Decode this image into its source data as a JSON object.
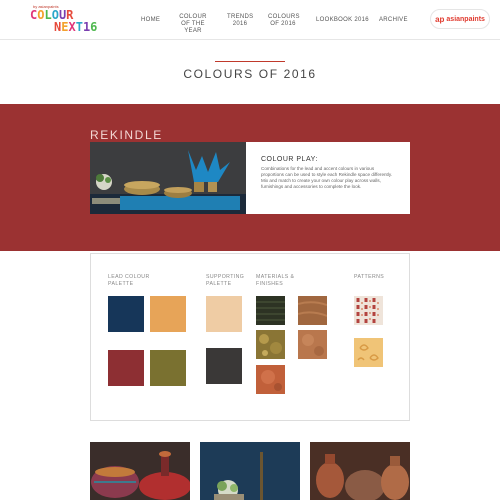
{
  "header": {
    "logo": {
      "small_text": "by asianpaints",
      "line1": [
        "C",
        "O",
        "L",
        "O",
        "U",
        "R"
      ],
      "line2": [
        "N",
        "E",
        "X",
        "T",
        "1",
        "6"
      ]
    },
    "nav": [
      {
        "label": "HOME"
      },
      {
        "label": "COLOUR OF THE YEAR"
      },
      {
        "label": "TRENDS 2016"
      },
      {
        "label": "COLOURS OF 2016"
      },
      {
        "label": "LOOKBOOK 2016"
      },
      {
        "label": "ARCHIVE"
      }
    ],
    "brand": {
      "mark": "ap",
      "text": "asianpaints"
    }
  },
  "page_title": "COLOURS OF 2016",
  "section": {
    "name": "REKINDLE",
    "card_heading": "COLOUR PLAY:",
    "card_body": "Combinations for the lead and accent colours in various proportions can be used to style each Rekindle space differently. Mix and match to create your own colour play across walls, furnishings and accessories to complete the look."
  },
  "palette": {
    "labels": {
      "lead": "LEAD COLOUR PALETTE",
      "supporting": "SUPPORTING PALETTE",
      "materials": "MATERIALS & FINISHES",
      "patterns": "PATTERNS"
    },
    "lead_colors": [
      "#163659",
      "#e7a458",
      "#8d2f33",
      "#7a7130"
    ],
    "supporting_colors": [
      "#efcca4",
      "#3a3837"
    ],
    "materials": [
      "wood-veneer-dark",
      "wood-veneer-light",
      "gilded-texture",
      "copper-texture",
      "terracotta-texture"
    ],
    "patterns": [
      "ikat-pattern",
      "paisley-pattern"
    ]
  },
  "gallery": [
    "vessels-photo",
    "plant-photo",
    "pottery-photo"
  ],
  "colors": {
    "accent_red": "#9b3232",
    "brand_red": "#e03a2e"
  }
}
